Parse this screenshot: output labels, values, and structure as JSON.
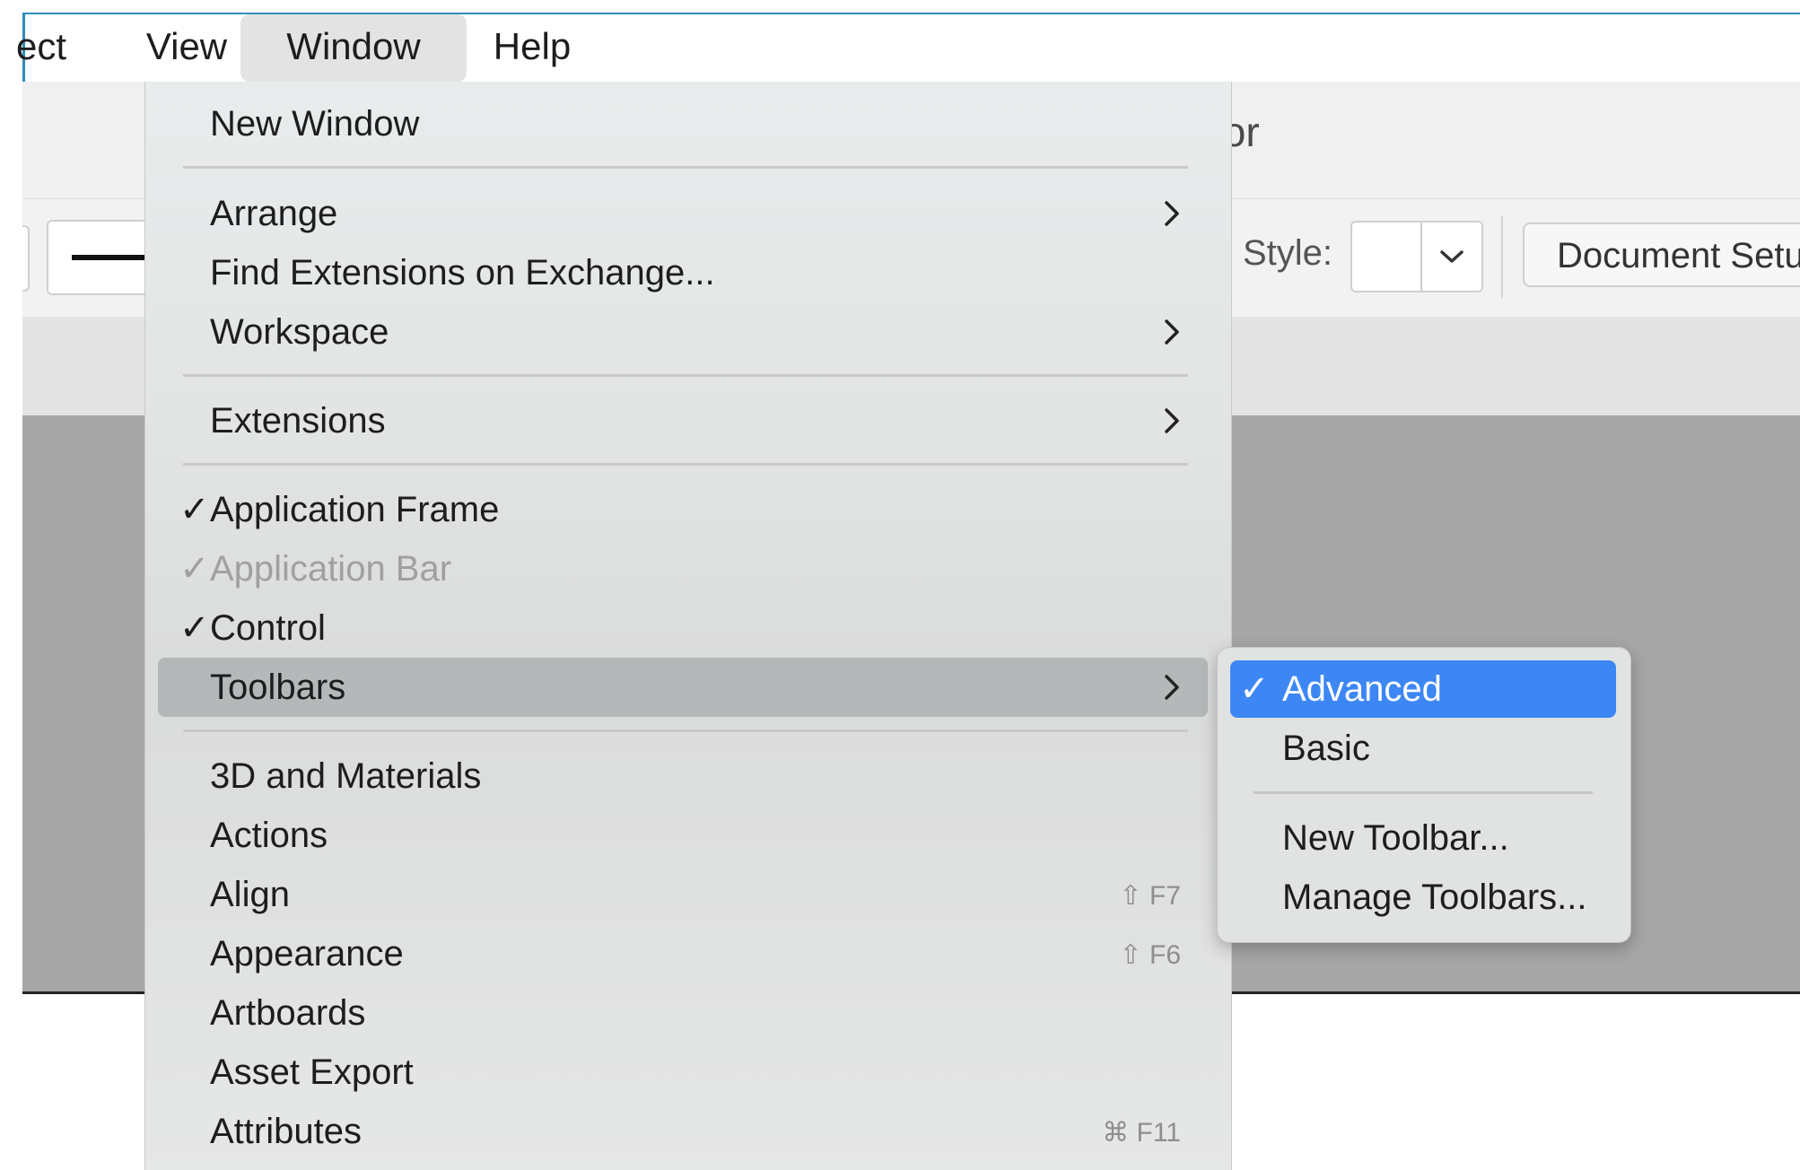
{
  "menubar": {
    "items": [
      {
        "label": "ect"
      },
      {
        "label": "View"
      },
      {
        "label": "Window"
      },
      {
        "label": "Help"
      }
    ]
  },
  "app": {
    "title_fragment": "tor",
    "style_label": "Style:",
    "document_setup_label": "Document Setu"
  },
  "window_menu": {
    "items": [
      {
        "label": "New Window"
      },
      {
        "label": "Arrange"
      },
      {
        "label": "Find Extensions on Exchange..."
      },
      {
        "label": "Workspace"
      },
      {
        "label": "Extensions"
      },
      {
        "label": "Application Frame",
        "check": "✓"
      },
      {
        "label": "Application Bar",
        "check": "✓"
      },
      {
        "label": "Control",
        "check": "✓"
      },
      {
        "label": "Toolbars"
      },
      {
        "label": "3D and Materials"
      },
      {
        "label": "Actions"
      },
      {
        "label": "Align",
        "shortcut": "⇧ F7"
      },
      {
        "label": "Appearance",
        "shortcut": "⇧ F6"
      },
      {
        "label": "Artboards"
      },
      {
        "label": "Asset Export"
      },
      {
        "label": "Attributes",
        "shortcut": "⌘ F11"
      }
    ]
  },
  "toolbars_submenu": {
    "items": [
      {
        "label": "Advanced",
        "check": "✓"
      },
      {
        "label": "Basic"
      },
      {
        "label": "New Toolbar..."
      },
      {
        "label": "Manage Toolbars..."
      }
    ]
  },
  "colors": {
    "selection_blue": "#3d87f5",
    "menubar_border": "#2b8fb8",
    "canvas_gray": "#a6a6a6"
  },
  "icons": {
    "submenu_arrow": "chevron-right-icon",
    "checkmark": "checkmark-icon",
    "dropdown": "chevron-down-icon"
  }
}
